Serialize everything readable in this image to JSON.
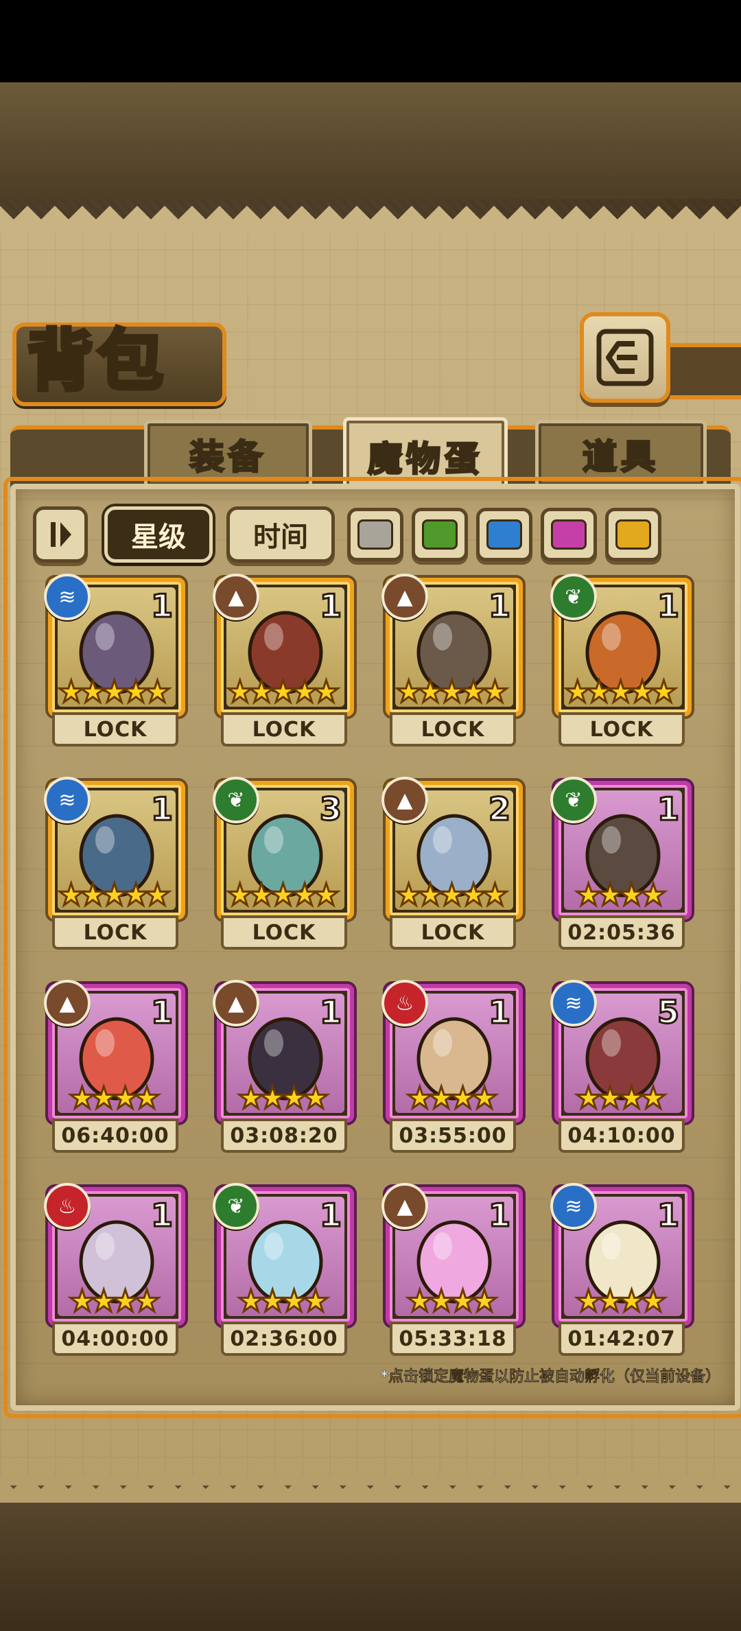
{
  "header": {
    "title": "背包",
    "back_icon": "return-icon"
  },
  "tabs": [
    {
      "label": "装备",
      "active": false
    },
    {
      "label": "魔物蛋",
      "active": true
    },
    {
      "label": "道具",
      "active": false
    }
  ],
  "filters": {
    "sort_toggle_icon": "sort-toggle-icon",
    "star_label": "星级",
    "time_label": "时间",
    "swatches": [
      "#a8a49a",
      "#4f9a2a",
      "#2f7fd0",
      "#c53fa8",
      "#e2a81e"
    ]
  },
  "eggs": [
    {
      "element": "water",
      "count": "1",
      "stars": 5,
      "frame": "gold",
      "status": "LOCK"
    },
    {
      "element": "earth",
      "count": "1",
      "stars": 5,
      "frame": "gold",
      "status": "LOCK"
    },
    {
      "element": "earth",
      "count": "1",
      "stars": 5,
      "frame": "gold",
      "status": "LOCK"
    },
    {
      "element": "grass",
      "count": "1",
      "stars": 5,
      "frame": "gold",
      "status": "LOCK"
    },
    {
      "element": "water",
      "count": "1",
      "stars": 5,
      "frame": "gold",
      "status": "LOCK"
    },
    {
      "element": "grass",
      "count": "3",
      "stars": 5,
      "frame": "gold",
      "status": "LOCK"
    },
    {
      "element": "earth",
      "count": "2",
      "stars": 5,
      "frame": "gold",
      "status": "LOCK"
    },
    {
      "element": "grass",
      "count": "1",
      "stars": 4,
      "frame": "pink",
      "status": "02:05:36"
    },
    {
      "element": "earth",
      "count": "1",
      "stars": 4,
      "frame": "pink",
      "status": "06:40:00"
    },
    {
      "element": "earth",
      "count": "1",
      "stars": 4,
      "frame": "pink",
      "status": "03:08:20"
    },
    {
      "element": "fire",
      "count": "1",
      "stars": 4,
      "frame": "pink",
      "status": "03:55:00"
    },
    {
      "element": "water",
      "count": "5",
      "stars": 4,
      "frame": "pink",
      "status": "04:10:00"
    },
    {
      "element": "fire",
      "count": "1",
      "stars": 4,
      "frame": "pink",
      "status": "04:00:00"
    },
    {
      "element": "grass",
      "count": "1",
      "stars": 4,
      "frame": "pink",
      "status": "02:36:00"
    },
    {
      "element": "earth",
      "count": "1",
      "stars": 4,
      "frame": "pink",
      "status": "05:33:18"
    },
    {
      "element": "water",
      "count": "1",
      "stars": 4,
      "frame": "pink",
      "status": "01:42:07"
    }
  ],
  "footnote": "*点击锁定魔物蛋以防止被自动孵化（仅当前设备）"
}
